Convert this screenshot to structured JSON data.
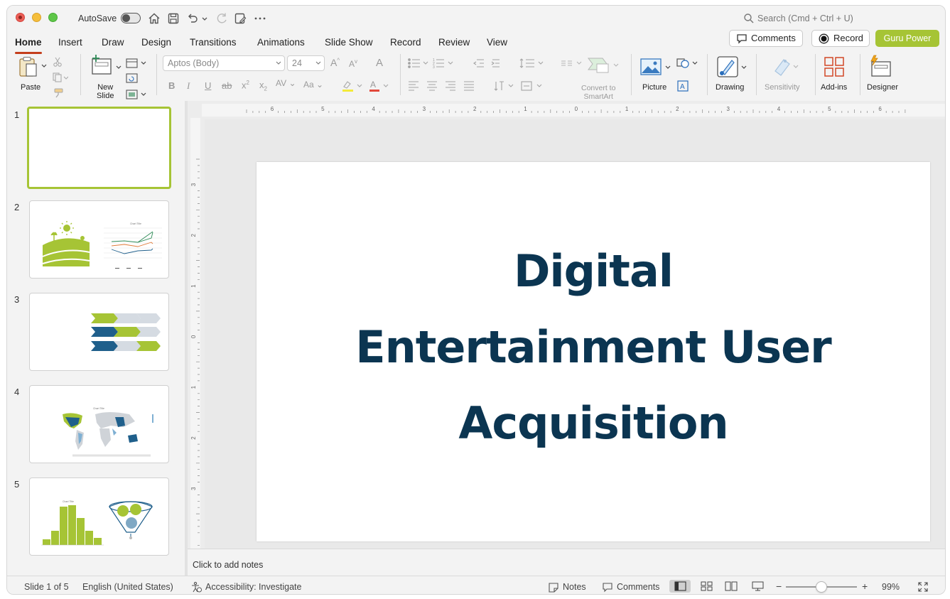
{
  "titlebar": {
    "autosave_label": "AutoSave",
    "search_placeholder": "Search (Cmd + Ctrl + U)"
  },
  "tabs": [
    {
      "label": "Home",
      "active": true
    },
    {
      "label": "Insert"
    },
    {
      "label": "Draw"
    },
    {
      "label": "Design"
    },
    {
      "label": "Transitions"
    },
    {
      "label": "Animations"
    },
    {
      "label": "Slide Show"
    },
    {
      "label": "Record"
    },
    {
      "label": "Review"
    },
    {
      "label": "View"
    }
  ],
  "header_buttons": {
    "comments": "Comments",
    "record": "Record",
    "guru": "Guru Power"
  },
  "ribbon": {
    "paste": "Paste",
    "new_slide_line1": "New",
    "new_slide_line2": "Slide",
    "font_name": "Aptos (Body)",
    "font_size": "24",
    "convert_line1": "Convert to",
    "convert_line2": "SmartArt",
    "picture": "Picture",
    "drawing": "Drawing",
    "sensitivity": "Sensitivity",
    "addins": "Add-ins",
    "designer": "Designer"
  },
  "slides": [
    {
      "number": "1",
      "selected": true
    },
    {
      "number": "2",
      "thumb_chart_title": "Chart Title"
    },
    {
      "number": "3"
    },
    {
      "number": "4",
      "thumb_chart_title": "Chart Title"
    },
    {
      "number": "5",
      "thumb_chart_title": "Chart Title"
    }
  ],
  "ruler": {
    "h_labels": [
      "6",
      "5",
      "4",
      "3",
      "2",
      "1",
      "0",
      "1",
      "2",
      "3",
      "4",
      "5",
      "6"
    ],
    "v_labels": [
      "3",
      "2",
      "1",
      "0",
      "1",
      "2",
      "3"
    ]
  },
  "slide": {
    "title_lines": [
      "Digital",
      "Entertainment User",
      "Acquisition"
    ],
    "title_color": "#0b3551"
  },
  "notes_placeholder": "Click to add notes",
  "status": {
    "slide_info": "Slide 1 of 5",
    "language": "English (United States)",
    "accessibility": "Accessibility: Investigate",
    "notes": "Notes",
    "comments": "Comments",
    "zoom": "99%",
    "zoom_level": 0.5
  },
  "colors": {
    "accent_green": "#a6c435",
    "title_navy": "#0b3551",
    "tab_underline": "#c43e1c"
  }
}
